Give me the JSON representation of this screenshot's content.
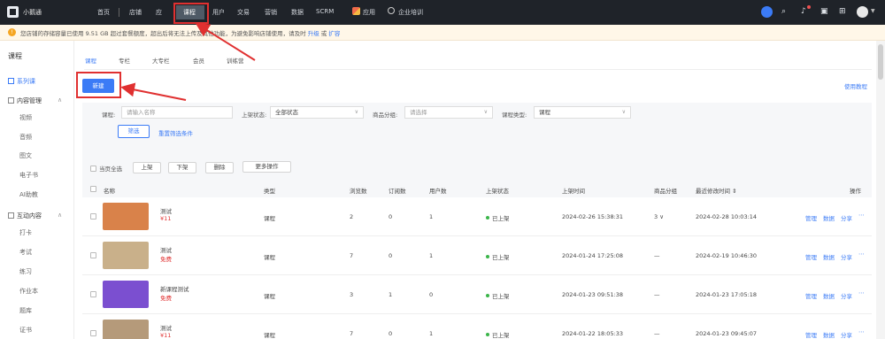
{
  "top_nav": {
    "app_name": "小鹅通",
    "items": [
      {
        "label": "首页",
        "icon": ""
      },
      {
        "label": "店铺",
        "icon": ""
      },
      {
        "label": "应",
        "icon": ""
      },
      {
        "label": "课程",
        "icon": "",
        "active": true
      },
      {
        "label": "用户",
        "icon": ""
      },
      {
        "label": "交易",
        "icon": ""
      },
      {
        "label": "营销",
        "icon": ""
      },
      {
        "label": "数据",
        "icon": ""
      },
      {
        "label": "SCRM",
        "icon": ""
      },
      {
        "label": "应用",
        "icon": "apps-icon"
      },
      {
        "label": "企业培训",
        "icon": "people-icon"
      }
    ]
  },
  "notice": {
    "text": "您店铺的存储容量已使用 9.51 GB 超过套餐额度，超出后将无法上传及其他功能，为避免影响店铺使用，请及时 ",
    "link1": "升级",
    "sep": " 或 ",
    "link2": "扩容"
  },
  "sidebar": {
    "title": "课程",
    "items": [
      {
        "label": "系列课",
        "active": true,
        "kind": "top"
      },
      {
        "label": "内容管理",
        "kind": "group"
      },
      {
        "label": "视频",
        "kind": "item"
      },
      {
        "label": "音频",
        "kind": "item"
      },
      {
        "label": "图文",
        "kind": "item"
      },
      {
        "label": "电子书",
        "kind": "item"
      },
      {
        "label": "AI助教",
        "kind": "item"
      },
      {
        "label": "互动内容",
        "kind": "group"
      },
      {
        "label": "打卡",
        "kind": "item"
      },
      {
        "label": "考试",
        "kind": "item"
      },
      {
        "label": "练习",
        "kind": "item"
      },
      {
        "label": "作业本",
        "kind": "item"
      },
      {
        "label": "题库",
        "kind": "item"
      },
      {
        "label": "证书",
        "kind": "item"
      }
    ]
  },
  "tabs": [
    "课程",
    "专栏",
    "大专栏",
    "会员",
    "训练营"
  ],
  "new_button": "新建",
  "help_link": "使用教程",
  "filters": {
    "name_label": "课程:",
    "name_placeholder": "请输入名称",
    "status_label": "上架状态:",
    "status_value": "全部状态",
    "group_label": "商品分组:",
    "group_placeholder": "请选择",
    "type_label": "课程类型:",
    "type_value": "课程",
    "filter_button": "筛选",
    "reset_link": "重置筛选条件"
  },
  "bulk": {
    "select_all": "当页全选",
    "buttons": [
      "上架",
      "下架",
      "删除",
      "更多操作"
    ]
  },
  "table": {
    "headers": [
      "名称",
      "类型",
      "浏览数",
      "订阅数",
      "用户数",
      "上架状态",
      "上架时间",
      "商品分组",
      "最近修改时间 ⇕",
      "操作"
    ],
    "rows": [
      {
        "title": "测试",
        "price": "¥11",
        "type": "课程",
        "views": "2",
        "subs": "0",
        "users": "1",
        "status": "已上架",
        "time": "2024-02-26 15:38:31",
        "group": "3 ∨",
        "modified": "2024-02-28 10:03:14",
        "ops": [
          "管理",
          "数据",
          "分享",
          "⋯"
        ],
        "color": "#d9824a"
      },
      {
        "title": "测试",
        "price": "免费",
        "type": "课程",
        "views": "7",
        "subs": "0",
        "users": "1",
        "status": "已上架",
        "time": "2024-01-24 17:25:08",
        "group": "—",
        "modified": "2024-02-19 10:46:30",
        "ops": [
          "管理",
          "数据",
          "分享",
          "⋯"
        ],
        "color": "#c9b08a"
      },
      {
        "title": "新课程测试",
        "price": "免费",
        "type": "课程",
        "views": "3",
        "subs": "1",
        "users": "0",
        "status": "已上架",
        "time": "2024-01-23 09:51:38",
        "group": "—",
        "modified": "2024-01-23 17:05:18",
        "ops": [
          "管理",
          "数据",
          "分享",
          "⋯"
        ],
        "color": "#7b4fd0"
      },
      {
        "title": "测试",
        "price": "¥11",
        "type": "课程",
        "views": "7",
        "subs": "0",
        "users": "1",
        "status": "已上架",
        "time": "2024-01-22 18:05:33",
        "group": "—",
        "modified": "2024-01-23 09:45:07",
        "ops": [
          "管理",
          "数据",
          "分享",
          "⋯"
        ],
        "color": "#b59a7a"
      }
    ]
  },
  "colors": {
    "accent": "#3b7bf6",
    "topbar": "#1f2329",
    "highlight": "#e03030"
  }
}
